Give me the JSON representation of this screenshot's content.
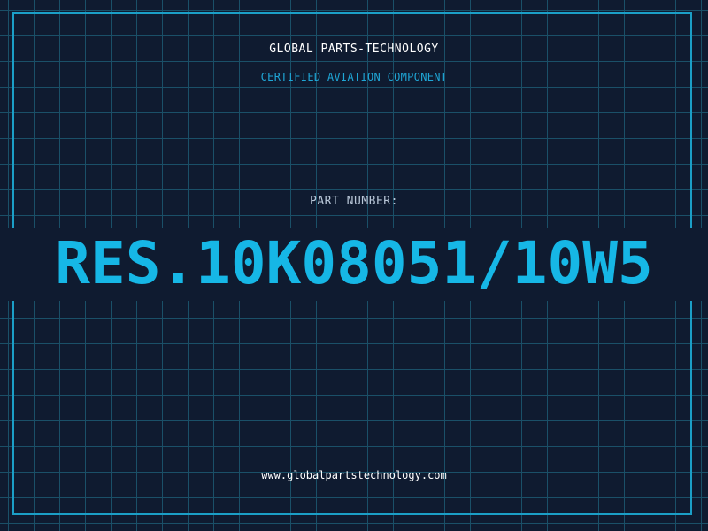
{
  "header": {
    "company_name": "GLOBAL PARTS-TECHNOLOGY",
    "tagline": "CERTIFIED AVIATION COMPONENT"
  },
  "part": {
    "label": "PART NUMBER:",
    "number": "RES.10K08051/10W5"
  },
  "footer": {
    "website": "www.globalpartstechnology.com"
  },
  "colors": {
    "background": "#0f1b30",
    "grid": "#1c5a72",
    "accent": "#16b7e6",
    "frame": "#1b9fc7",
    "label": "#b9c7d8",
    "text": "#ffffff"
  }
}
